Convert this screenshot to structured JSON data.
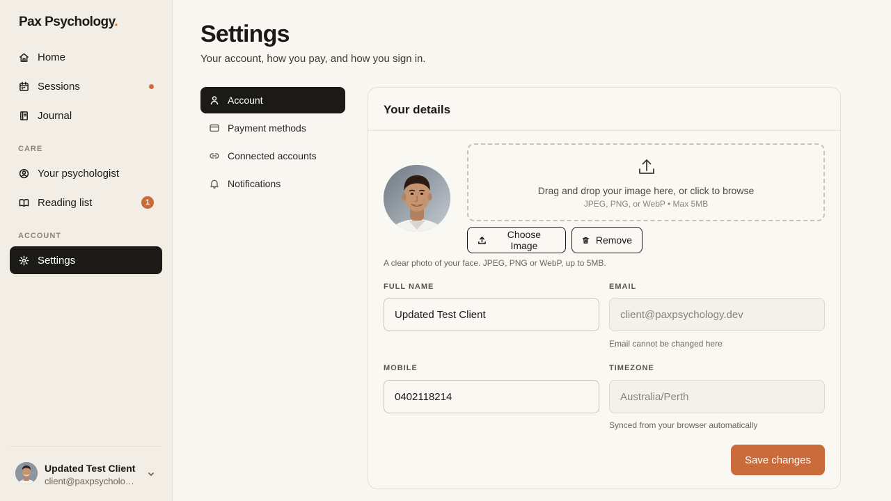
{
  "brand": {
    "name": "Pax Psychology",
    "dot": ".",
    "accent": "#c96b3a"
  },
  "sidebar": {
    "items": [
      {
        "label": "Home"
      },
      {
        "label": "Sessions"
      },
      {
        "label": "Journal"
      },
      {
        "label": "Your psychologist"
      },
      {
        "label": "Reading list",
        "badge": "1"
      },
      {
        "label": "Settings"
      }
    ],
    "sections": {
      "care": "CARE",
      "account": "ACCOUNT"
    },
    "user": {
      "name": "Updated Test Client",
      "email": "client@paxpsychology.dev"
    }
  },
  "page": {
    "title": "Settings",
    "subtitle": "Your account, how you pay, and how you sign in."
  },
  "subnav": {
    "items": [
      {
        "label": "Account"
      },
      {
        "label": "Payment methods"
      },
      {
        "label": "Connected accounts"
      },
      {
        "label": "Notifications"
      }
    ]
  },
  "card": {
    "title": "Your details",
    "dropzone": {
      "main": "Drag and drop your image here, or click to browse",
      "sub": "JPEG, PNG, or WebP • Max 5MB"
    },
    "choose_label": "Choose Image",
    "remove_label": "Remove",
    "photo_hint": "A clear photo of your face. JPEG, PNG or WebP, up to 5MB.",
    "fields": {
      "full_name": {
        "label": "FULL NAME",
        "value": "Updated Test Client"
      },
      "email": {
        "label": "EMAIL",
        "value": "client@paxpsychology.dev",
        "help": "Email cannot be changed here"
      },
      "mobile": {
        "label": "MOBILE",
        "value": "0402118214"
      },
      "timezone": {
        "label": "TIMEZONE",
        "value": "Australia/Perth",
        "help": "Synced from your browser automatically"
      }
    },
    "save_label": "Save changes"
  }
}
